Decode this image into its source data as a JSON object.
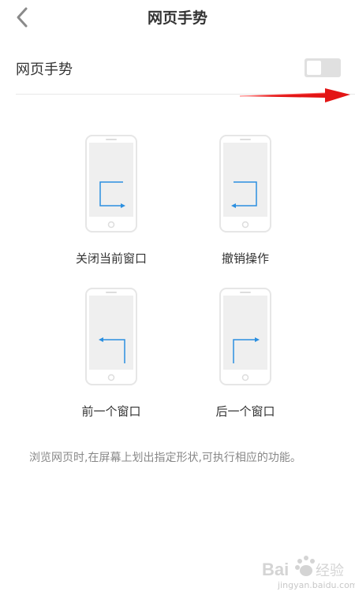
{
  "header": {
    "title": "网页手势"
  },
  "setting": {
    "label": "网页手势",
    "toggle_on": false
  },
  "gestures": [
    {
      "label": "关闭当前窗口"
    },
    {
      "label": "撤销操作"
    },
    {
      "label": "前一个窗口"
    },
    {
      "label": "后一个窗口"
    }
  ],
  "description": "浏览网页时,在屏幕上划出指定形状,可执行相应的功能。",
  "watermark": {
    "logo_text": "Baidu经验",
    "url": "jingyan.baidu.com"
  },
  "colors": {
    "accent_blue": "#2b8fe0",
    "annotation_red": "#e31515",
    "toggle_off": "#e0e0e0"
  }
}
